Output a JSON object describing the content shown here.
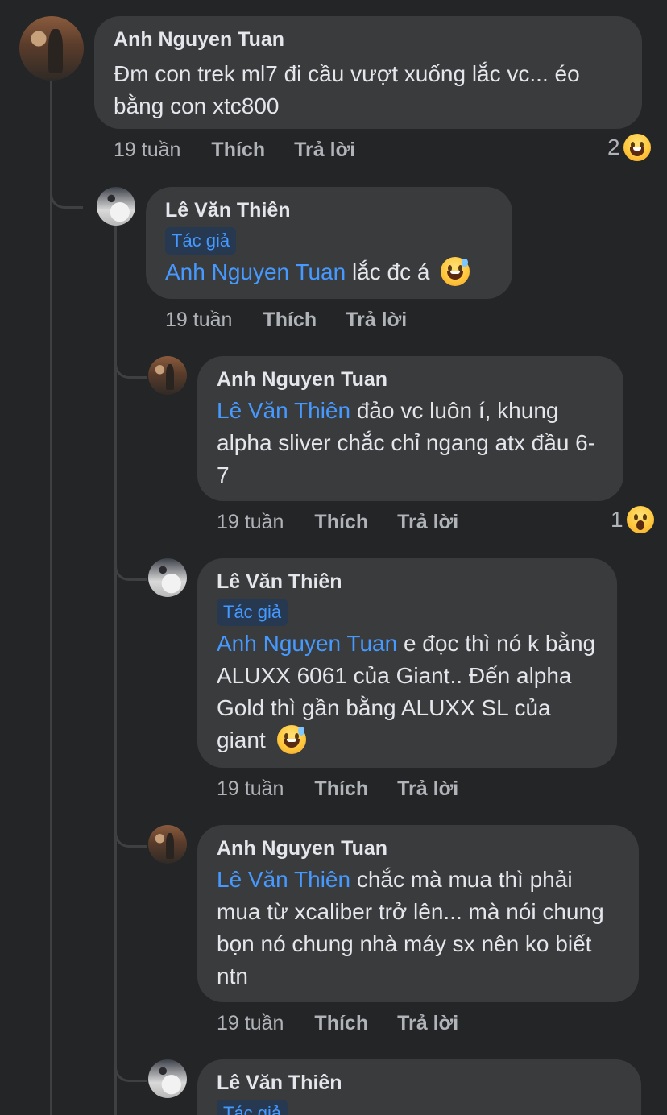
{
  "comments": [
    {
      "author": "Anh Nguyen Tuan",
      "badge": "",
      "mention": "",
      "text": "Đm con trek ml7 đi cầu vượt xuống lắc vc... éo bằng con xtc800",
      "time": "19 tuần",
      "like": "Thích",
      "reply": "Trả lời",
      "reaction_count": "2",
      "reaction_icon": "laughing-emoji-icon"
    },
    {
      "author": "Lê Văn Thiên",
      "badge": "Tác giả",
      "mention": "Anh Nguyen Tuan",
      "text": " lắc đc á ",
      "time": "19 tuần",
      "like": "Thích",
      "reply": "Trả lời"
    },
    {
      "author": "Anh Nguyen Tuan",
      "badge": "",
      "mention": "Lê Văn Thiên",
      "text": " đảo vc luôn í, khung alpha sliver chắc chỉ ngang atx đầu 6-7",
      "time": "19 tuần",
      "like": "Thích",
      "reply": "Trả lời",
      "reaction_count": "1",
      "reaction_icon": "wow-emoji-icon"
    },
    {
      "author": "Lê Văn Thiên",
      "badge": "Tác giả",
      "mention": "Anh Nguyen Tuan",
      "text": " e đọc thì nó k bằng ALUXX 6061 của Giant.. Đến alpha Gold thì gần bằng ALUXX SL của giant ",
      "time": "19 tuần",
      "like": "Thích",
      "reply": "Trả lời"
    },
    {
      "author": "Anh Nguyen Tuan",
      "badge": "",
      "mention": "Lê Văn Thiên",
      "text": " chắc mà mua thì phải mua từ xcaliber trở lên... mà nói chung bọn nó chung nhà máy sx nên ko biết ntn",
      "time": "19 tuần",
      "like": "Thích",
      "reply": "Trả lời"
    },
    {
      "author": "Lê Văn Thiên",
      "badge": "Tác giả"
    }
  ]
}
